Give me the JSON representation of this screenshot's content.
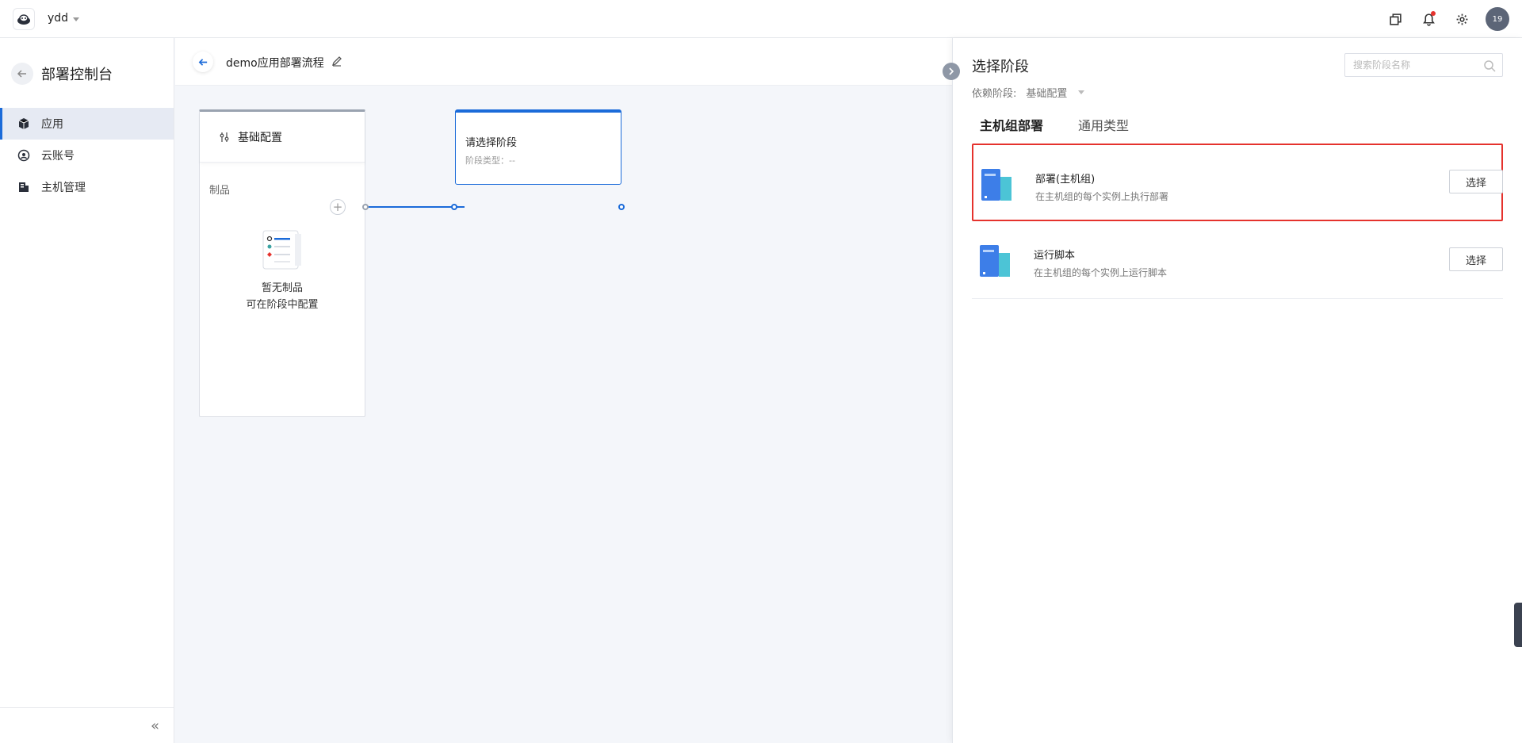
{
  "topbar": {
    "team_name": "ydd",
    "icons": [
      "copy-icon",
      "bell-icon",
      "gear-icon"
    ],
    "avatar_text": "19"
  },
  "sidebar": {
    "title": "部署控制台",
    "items": [
      {
        "label": "应用",
        "icon": "cube-icon",
        "active": true
      },
      {
        "label": "云账号",
        "icon": "account-icon",
        "active": false
      },
      {
        "label": "主机管理",
        "icon": "server-icon",
        "active": false
      }
    ],
    "collapse_label": "«"
  },
  "main": {
    "pipeline_title": "demo应用部署流程",
    "stage1": {
      "title": "基础配置",
      "section_label": "制品",
      "empty_line1": "暂无制品",
      "empty_line2": "可在阶段中配置"
    },
    "stage2": {
      "title": "请选择阶段",
      "type_label": "阶段类型：--"
    },
    "add_label": "+"
  },
  "drawer": {
    "title": "选择阶段",
    "search_placeholder": "搜索阶段名称",
    "dependency_label": "依赖阶段:",
    "dependency_value": "基础配置",
    "tabs": [
      {
        "label": "主机组部署",
        "active": true
      },
      {
        "label": "通用类型",
        "active": false
      }
    ],
    "types": [
      {
        "name": "部署(主机组)",
        "desc": "在主机组的每个实例上执行部署",
        "button": "选择",
        "highlighted": true
      },
      {
        "name": "运行脚本",
        "desc": "在主机组的每个实例上运行脚本",
        "button": "选择",
        "highlighted": false
      }
    ]
  },
  "colors": {
    "accent": "#1b6bd9",
    "highlight_border": "#e5322d",
    "notification_dot": "#e5322d"
  }
}
